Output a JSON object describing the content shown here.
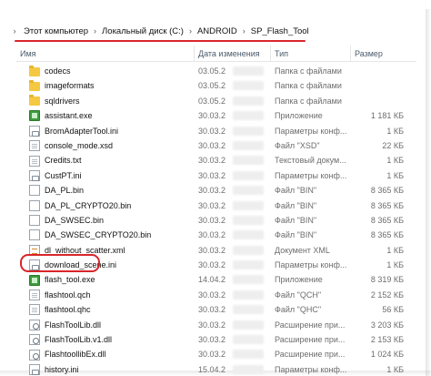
{
  "breadcrumb": {
    "items": [
      "Этот компьютер",
      "Локальный диск (C:)",
      "ANDROID",
      "SP_Flash_Tool"
    ],
    "separator": "›"
  },
  "columns": {
    "name": "Имя",
    "date": "Дата изменения",
    "type": "Тип",
    "size": "Размер"
  },
  "highlight_color": "#d9262b",
  "files": [
    {
      "icon": "folder-icon",
      "name": "codecs",
      "date": "03.05.2",
      "type": "Папка с файлами",
      "size": ""
    },
    {
      "icon": "folder-icon",
      "name": "imageformats",
      "date": "03.05.2",
      "type": "Папка с файлами",
      "size": ""
    },
    {
      "icon": "folder-icon",
      "name": "sqldrivers",
      "date": "03.05.2",
      "type": "Папка с файлами",
      "size": ""
    },
    {
      "icon": "exe-icon",
      "name": "assistant.exe",
      "date": "30.03.2",
      "type": "Приложение",
      "size": "1 181 КБ"
    },
    {
      "icon": "ini-icon",
      "name": "BromAdapterTool.ini",
      "date": "30.03.2",
      "type": "Параметры конф...",
      "size": "1 КБ"
    },
    {
      "icon": "doc-icon",
      "name": "console_mode.xsd",
      "date": "30.03.2",
      "type": "Файл \"XSD\"",
      "size": "22 КБ"
    },
    {
      "icon": "txt-icon",
      "name": "Credits.txt",
      "date": "30.03.2",
      "type": "Текстовый докум...",
      "size": "1 КБ"
    },
    {
      "icon": "ini-icon",
      "name": "CustPT.ini",
      "date": "30.03.2",
      "type": "Параметры конф...",
      "size": "1 КБ"
    },
    {
      "icon": "bin-icon",
      "name": "DA_PL.bin",
      "date": "30.03.2",
      "type": "Файл \"BIN\"",
      "size": "8 365 КБ"
    },
    {
      "icon": "bin-icon",
      "name": "DA_PL_CRYPTO20.bin",
      "date": "30.03.2",
      "type": "Файл \"BIN\"",
      "size": "8 365 КБ"
    },
    {
      "icon": "bin-icon",
      "name": "DA_SWSEC.bin",
      "date": "30.03.2",
      "type": "Файл \"BIN\"",
      "size": "8 365 КБ"
    },
    {
      "icon": "bin-icon",
      "name": "DA_SWSEC_CRYPTO20.bin",
      "date": "30.03.2",
      "type": "Файл \"BIN\"",
      "size": "8 365 КБ"
    },
    {
      "icon": "xml-icon",
      "name": "dl_without_scatter.xml",
      "date": "30.03.2",
      "type": "Документ XML",
      "size": "1 КБ"
    },
    {
      "icon": "ini-icon",
      "name": "download_scene.ini",
      "date": "30.03.2",
      "type": "Параметры конф...",
      "size": "1 КБ"
    },
    {
      "icon": "exe-icon",
      "name": "flash_tool.exe",
      "date": "14.04.2",
      "type": "Приложение",
      "size": "8 319 КБ"
    },
    {
      "icon": "doc-icon",
      "name": "flashtool.qch",
      "date": "30.03.2",
      "type": "Файл \"QCH\"",
      "size": "2 152 КБ"
    },
    {
      "icon": "doc-icon",
      "name": "flashtool.qhc",
      "date": "30.03.2",
      "type": "Файл \"QHC\"",
      "size": "56 КБ"
    },
    {
      "icon": "dll-icon",
      "name": "FlashToolLib.dll",
      "date": "30.03.2",
      "type": "Расширение при...",
      "size": "3 203 КБ"
    },
    {
      "icon": "dll-icon",
      "name": "FlashToolLib.v1.dll",
      "date": "30.03.2",
      "type": "Расширение при...",
      "size": "2 153 КБ"
    },
    {
      "icon": "dll-icon",
      "name": "FlashtoollibEx.dll",
      "date": "30.03.2",
      "type": "Расширение при...",
      "size": "1 024 КБ"
    },
    {
      "icon": "ini-icon",
      "name": "history.ini",
      "date": "15.04.2",
      "type": "Параметры конф...",
      "size": "1 КБ"
    }
  ]
}
